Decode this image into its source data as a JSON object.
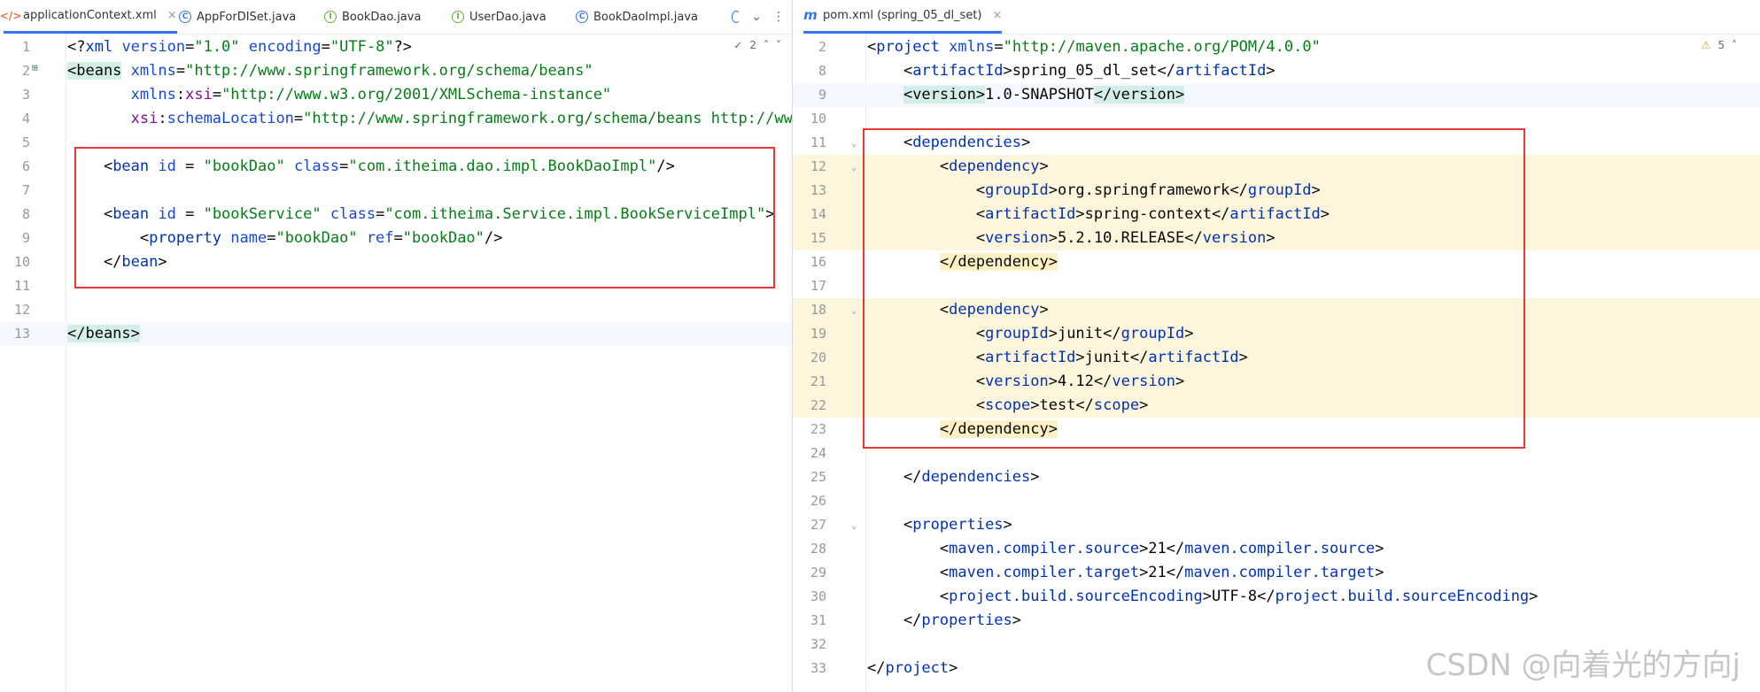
{
  "left": {
    "tabs": [
      {
        "label": "applicationContext.xml",
        "icon": "xml-file-icon",
        "active": true,
        "close": "×"
      },
      {
        "label": "AppForDISet.java",
        "icon": "java-class-icon"
      },
      {
        "label": "BookDao.java",
        "icon": "java-interface-icon"
      },
      {
        "label": "UserDao.java",
        "icon": "java-interface-icon"
      },
      {
        "label": "BookDaoImpl.java",
        "icon": "java-class-icon"
      }
    ],
    "inspection": {
      "check": "✓",
      "count": "2",
      "up": "˄",
      "down": "˅"
    },
    "lines": [
      {
        "n": "1",
        "tokens": [
          [
            "p",
            "<?"
          ],
          [
            "t",
            "xml"
          ],
          [
            "a",
            " version"
          ],
          [
            "p",
            "="
          ],
          [
            "v",
            "\"1.0\""
          ],
          [
            "a",
            " encoding"
          ],
          [
            "p",
            "="
          ],
          [
            "v",
            "\"UTF-8\""
          ],
          [
            "p",
            "?>"
          ]
        ]
      },
      {
        "n": "2",
        "tokens": [
          [
            "tb",
            "<beans"
          ],
          [
            "a",
            " xmlns"
          ],
          [
            "p",
            "="
          ],
          [
            "v",
            "\"http://www.springframework.org/schema/beans\""
          ]
        ]
      },
      {
        "n": "3",
        "tokens": [
          [
            "p",
            "       "
          ],
          [
            "a",
            "xmlns"
          ],
          [
            "p",
            ":"
          ],
          [
            "ns",
            "xsi"
          ],
          [
            "p",
            "="
          ],
          [
            "v",
            "\"http://www.w3.org/2001/XMLSchema-instance\""
          ]
        ]
      },
      {
        "n": "4",
        "tokens": [
          [
            "p",
            "       "
          ],
          [
            "ns",
            "xsi"
          ],
          [
            "p",
            ":"
          ],
          [
            "a",
            "schemaLocation"
          ],
          [
            "p",
            "="
          ],
          [
            "v",
            "\"http://www.springframework.org/schema/beans http://www."
          ]
        ]
      },
      {
        "n": "5",
        "tokens": []
      },
      {
        "n": "6",
        "tokens": [
          [
            "p",
            "    <"
          ],
          [
            "t",
            "bean"
          ],
          [
            "a",
            " id"
          ],
          [
            "p",
            " = "
          ],
          [
            "v",
            "\"bookDao\""
          ],
          [
            "a",
            " class"
          ],
          [
            "p",
            "="
          ],
          [
            "v",
            "\"com.itheima.dao.impl.BookDaoImpl\""
          ],
          [
            "p",
            "/>"
          ]
        ]
      },
      {
        "n": "7",
        "tokens": []
      },
      {
        "n": "8",
        "tokens": [
          [
            "p",
            "    <"
          ],
          [
            "t",
            "bean"
          ],
          [
            "a",
            " id"
          ],
          [
            "p",
            " = "
          ],
          [
            "v",
            "\"bookService\""
          ],
          [
            "a",
            " class"
          ],
          [
            "p",
            "="
          ],
          [
            "v",
            "\"com.itheima.Service.impl.BookServiceImpl\""
          ],
          [
            "p",
            ">"
          ]
        ]
      },
      {
        "n": "9",
        "tokens": [
          [
            "p",
            "        <"
          ],
          [
            "t",
            "property"
          ],
          [
            "a",
            " name"
          ],
          [
            "p",
            "="
          ],
          [
            "v",
            "\"bookDao\""
          ],
          [
            "a",
            " ref"
          ],
          [
            "p",
            "="
          ],
          [
            "v",
            "\"bookDao\""
          ],
          [
            "p",
            "/>"
          ]
        ]
      },
      {
        "n": "10",
        "tokens": [
          [
            "p",
            "    </"
          ],
          [
            "t",
            "bean"
          ],
          [
            "p",
            ">"
          ]
        ]
      },
      {
        "n": "11",
        "tokens": []
      },
      {
        "n": "12",
        "tokens": []
      },
      {
        "n": "13",
        "tokens": [
          [
            "tb",
            "</beans>"
          ]
        ],
        "cur": true
      }
    ]
  },
  "right": {
    "tabs": [
      {
        "label": "pom.xml (spring_05_dl_set)",
        "icon": "maven-icon",
        "active": true,
        "close": "×"
      }
    ],
    "inspection": {
      "warn": "⚠",
      "count": "5",
      "up": "˄"
    },
    "lines": [
      {
        "n": "2",
        "tokens": [
          [
            "p",
            "<"
          ],
          [
            "t",
            "project"
          ],
          [
            "a",
            " xmlns"
          ],
          [
            "p",
            "="
          ],
          [
            "v",
            "\"http://maven.apache.org/POM/4.0.0\""
          ]
        ]
      },
      {
        "n": "8",
        "tokens": [
          [
            "p",
            "    <"
          ],
          [
            "t",
            "artifactId"
          ],
          [
            "p",
            ">spring_05_dl_set</"
          ],
          [
            "t",
            "artifactId"
          ],
          [
            "p",
            ">"
          ]
        ]
      },
      {
        "n": "9",
        "tokens": [
          [
            "p",
            "    "
          ],
          [
            "tb",
            "<version>"
          ],
          [
            "p",
            "1.0-SNAPSHOT"
          ],
          [
            "tb",
            "</version>"
          ]
        ],
        "cur": true
      },
      {
        "n": "10",
        "tokens": []
      },
      {
        "n": "11",
        "fold": true,
        "tokens": [
          [
            "p",
            "    <"
          ],
          [
            "t",
            "dependencies"
          ],
          [
            "p",
            ">"
          ]
        ]
      },
      {
        "n": "12",
        "fold": true,
        "hl": true,
        "tokens": [
          [
            "p",
            "        <"
          ],
          [
            "t",
            "dependency"
          ],
          [
            "p",
            ">"
          ]
        ]
      },
      {
        "n": "13",
        "hl": true,
        "tokens": [
          [
            "p",
            "            <"
          ],
          [
            "t",
            "groupId"
          ],
          [
            "p",
            ">org.springframework</"
          ],
          [
            "t",
            "groupId"
          ],
          [
            "p",
            ">"
          ]
        ]
      },
      {
        "n": "14",
        "hl": true,
        "tokens": [
          [
            "p",
            "            <"
          ],
          [
            "t",
            "artifactId"
          ],
          [
            "p",
            ">spring-context</"
          ],
          [
            "t",
            "artifactId"
          ],
          [
            "p",
            ">"
          ]
        ]
      },
      {
        "n": "15",
        "hl": true,
        "tokens": [
          [
            "p",
            "            <"
          ],
          [
            "t",
            "version"
          ],
          [
            "p",
            ">5.2.10.RELEASE</"
          ],
          [
            "t",
            "version"
          ],
          [
            "p",
            ">"
          ]
        ]
      },
      {
        "n": "16",
        "tokens": [
          [
            "p",
            "        "
          ],
          [
            "wb",
            "</dependency>"
          ]
        ]
      },
      {
        "n": "17",
        "tokens": []
      },
      {
        "n": "18",
        "fold": true,
        "hl": true,
        "tokens": [
          [
            "p",
            "        <"
          ],
          [
            "t",
            "dependency"
          ],
          [
            "p",
            ">"
          ]
        ]
      },
      {
        "n": "19",
        "hl": true,
        "tokens": [
          [
            "p",
            "            <"
          ],
          [
            "t",
            "groupId"
          ],
          [
            "p",
            ">junit</"
          ],
          [
            "t",
            "groupId"
          ],
          [
            "p",
            ">"
          ]
        ]
      },
      {
        "n": "20",
        "hl": true,
        "tokens": [
          [
            "p",
            "            <"
          ],
          [
            "t",
            "artifactId"
          ],
          [
            "p",
            ">junit</"
          ],
          [
            "t",
            "artifactId"
          ],
          [
            "p",
            ">"
          ]
        ]
      },
      {
        "n": "21",
        "hl": true,
        "tokens": [
          [
            "p",
            "            <"
          ],
          [
            "t",
            "version"
          ],
          [
            "p",
            ">4.12</"
          ],
          [
            "t",
            "version"
          ],
          [
            "p",
            ">"
          ]
        ]
      },
      {
        "n": "22",
        "hl": true,
        "tokens": [
          [
            "p",
            "            <"
          ],
          [
            "t",
            "scope"
          ],
          [
            "p",
            ">test</"
          ],
          [
            "t",
            "scope"
          ],
          [
            "p",
            ">"
          ]
        ]
      },
      {
        "n": "23",
        "tokens": [
          [
            "p",
            "        "
          ],
          [
            "wb",
            "</dependency>"
          ]
        ]
      },
      {
        "n": "24",
        "tokens": []
      },
      {
        "n": "25",
        "tokens": [
          [
            "p",
            "    </"
          ],
          [
            "t",
            "dependencies"
          ],
          [
            "p",
            ">"
          ]
        ]
      },
      {
        "n": "26",
        "tokens": []
      },
      {
        "n": "27",
        "fold": true,
        "tokens": [
          [
            "p",
            "    <"
          ],
          [
            "t",
            "properties"
          ],
          [
            "p",
            ">"
          ]
        ]
      },
      {
        "n": "28",
        "tokens": [
          [
            "p",
            "        <"
          ],
          [
            "t",
            "maven.compiler.source"
          ],
          [
            "p",
            ">21</"
          ],
          [
            "t",
            "maven.compiler.source"
          ],
          [
            "p",
            ">"
          ]
        ]
      },
      {
        "n": "29",
        "tokens": [
          [
            "p",
            "        <"
          ],
          [
            "t",
            "maven.compiler.target"
          ],
          [
            "p",
            ">21</"
          ],
          [
            "t",
            "maven.compiler.target"
          ],
          [
            "p",
            ">"
          ]
        ]
      },
      {
        "n": "30",
        "tokens": [
          [
            "p",
            "        <"
          ],
          [
            "t",
            "project.build.sourceEncoding"
          ],
          [
            "p",
            ">UTF-8</"
          ],
          [
            "t",
            "project.build.sourceEncoding"
          ],
          [
            "p",
            ">"
          ]
        ]
      },
      {
        "n": "31",
        "tokens": [
          [
            "p",
            "    </"
          ],
          [
            "t",
            "properties"
          ],
          [
            "p",
            ">"
          ]
        ]
      },
      {
        "n": "32",
        "tokens": []
      },
      {
        "n": "33",
        "tokens": [
          [
            "p",
            "</"
          ],
          [
            "t",
            "project"
          ],
          [
            "p",
            ">"
          ]
        ]
      }
    ]
  },
  "watermark": "CSDN @向着光的方向j",
  "colors": {
    "annotation": "#e53935",
    "tab_accent": "#3574f0",
    "highlight": "#fdf6dc"
  }
}
